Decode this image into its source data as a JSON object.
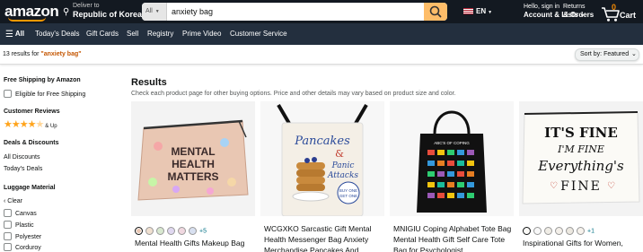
{
  "header": {
    "logo": "amazon",
    "deliver_line1": "Deliver to",
    "deliver_line2": "Republic of Korea",
    "search_category": "All",
    "search_value": "anxiety bag",
    "language": "EN",
    "account_line1": "Hello, sign in",
    "account_line2": "Account & Lists",
    "returns_line1": "Returns",
    "returns_line2": "& Orders",
    "cart_count": "0",
    "cart_label": "Cart",
    "colors": {
      "nav_bg": "#131921",
      "subnav_bg": "#232f3e",
      "search_button": "#febd69",
      "accent": "#ff9900"
    }
  },
  "subnav": {
    "items": [
      "All",
      "Today's Deals",
      "Gift Cards",
      "Sell",
      "Registry",
      "Prime Video",
      "Customer Service"
    ]
  },
  "results_bar": {
    "count_text": "13 results for ",
    "query": "\"anxiety bag\"",
    "sort_label": "Sort by: Featured"
  },
  "sidebar": {
    "free_shipping_heading": "Free Shipping by Amazon",
    "free_shipping_option": "Eligible for Free Shipping",
    "reviews_heading": "Customer Reviews",
    "reviews_stars": 4,
    "reviews_suffix": "& Up",
    "deals_heading": "Deals & Discounts",
    "deals_items": [
      "All Discounts",
      "Today's Deals"
    ],
    "material_heading": "Luggage Material",
    "clear_label": "Clear",
    "materials": [
      "Canvas",
      "Plastic",
      "Polyester",
      "Corduroy"
    ]
  },
  "main": {
    "heading": "Results",
    "subtext": "Check each product page for other buying options. Price and other details may vary based on product size and color.",
    "products": [
      {
        "title": "Mental Health Gifts Makeup Bag",
        "image_text": [
          "MENTAL",
          "HEALTH",
          "MATTERS"
        ],
        "more_swatches": "+5"
      },
      {
        "title": "WCGXKO Sarcastic Gift Mental Health Messenger Bag Anxiety Merchandise Pancakes And",
        "image_text": [
          "Pancakes",
          "&",
          "Panic",
          "Attacks",
          "BUY ONE",
          "GET ONE"
        ],
        "more_swatches": ""
      },
      {
        "title": "MNIGIU Coping Alphabet Tote Bag Mental Health Gift Self Care Tote Bag for Psychologist",
        "image_text": [
          "ABC'S OF COPING"
        ],
        "more_swatches": ""
      },
      {
        "title": "Inspirational Gifts for Women,",
        "image_text": [
          "IT'S FINE",
          "I'M FINE",
          "Everything's",
          "FINE"
        ],
        "more_swatches": "+1"
      }
    ]
  }
}
